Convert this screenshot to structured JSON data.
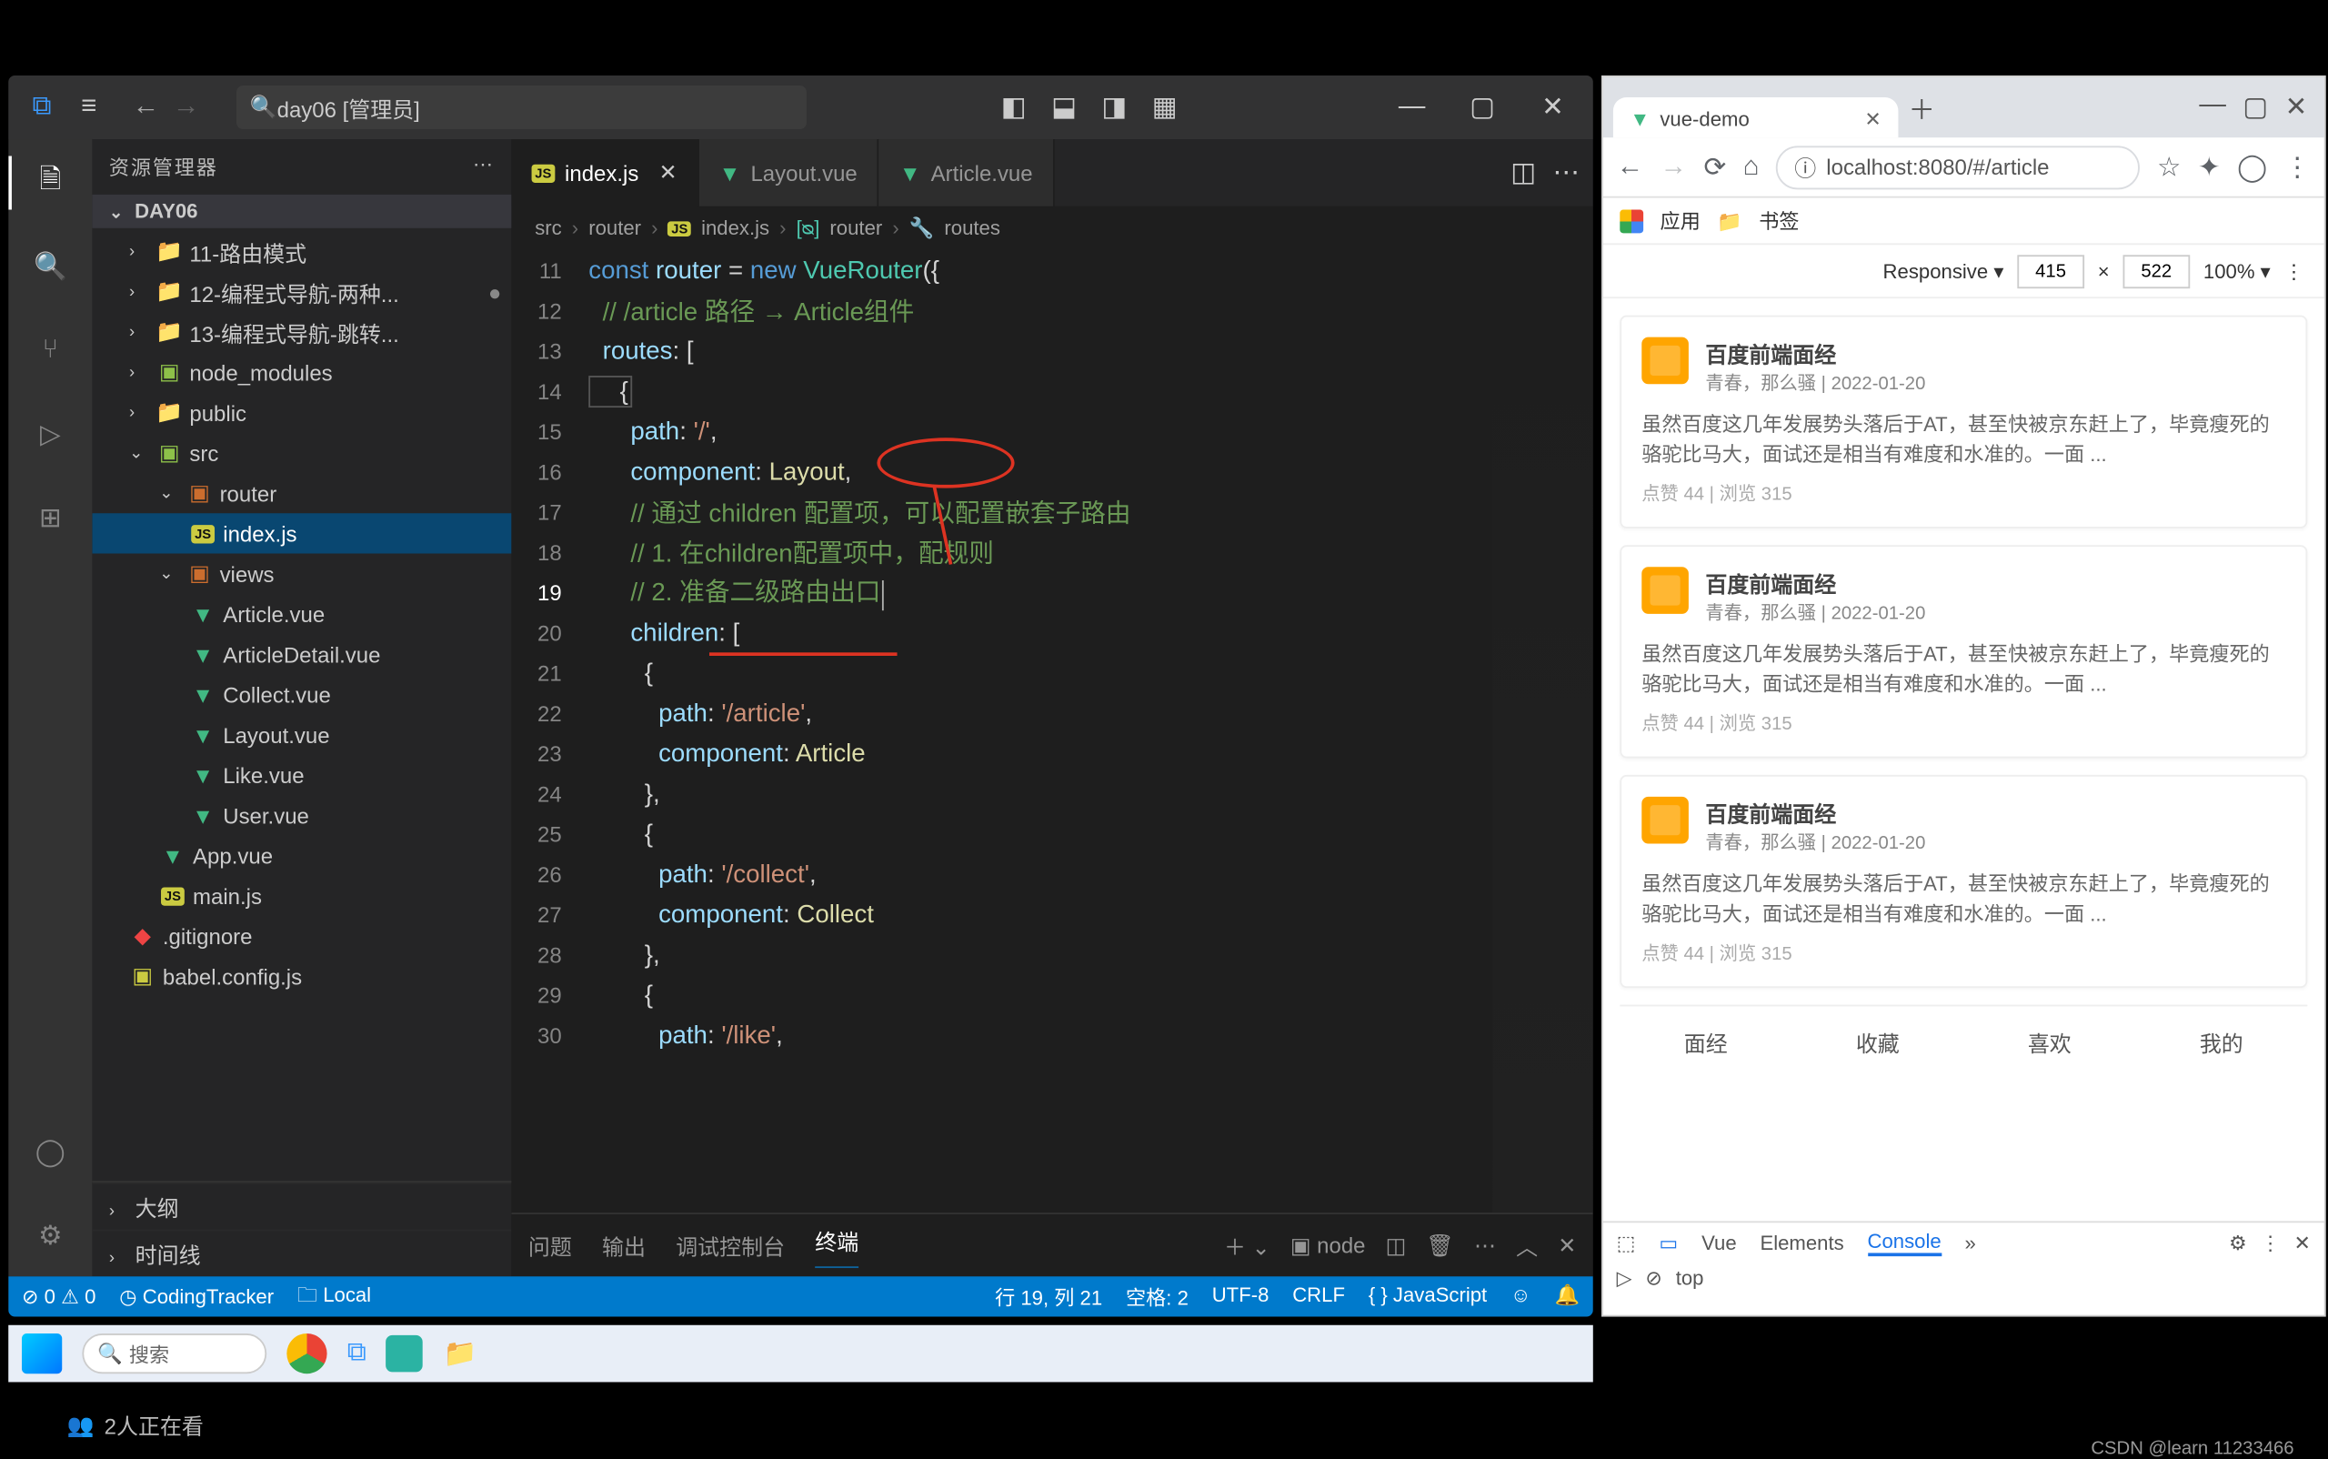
{
  "vscode": {
    "search_placeholder": "day06 [管理员]",
    "explorer_title": "资源管理器",
    "project_name": "DAY06",
    "tree": {
      "f1": "11-路由模式",
      "f2": "12-编程式导航-两种...",
      "f3": "13-编程式导航-跳转...",
      "nm": "node_modules",
      "pub": "public",
      "src": "src",
      "router": "router",
      "indexjs": "index.js",
      "views": "views",
      "article": "Article.vue",
      "artdetail": "ArticleDetail.vue",
      "collect": "Collect.vue",
      "layout": "Layout.vue",
      "like": "Like.vue",
      "user": "User.vue",
      "app": "App.vue",
      "main": "main.js",
      "gitig": ".gitignore",
      "babel": "babel.config.js",
      "outline": "大纲",
      "timeline": "时间线"
    },
    "tabs": {
      "index": "index.js",
      "layout": "Layout.vue",
      "article": "Article.vue"
    },
    "breadcrumb": [
      "src",
      "router",
      "index.js",
      "router",
      "routes"
    ],
    "code": {
      "l11a": "const ",
      "l11b": "router",
      "l11c": " = ",
      "l11d": "new ",
      "l11e": "VueRouter",
      "l11f": "({",
      "l12": "  // /article 路径 → Article组件",
      "l13a": "  routes",
      "l13b": ": [",
      "l14": "    {",
      "l15a": "      path",
      "l15b": ": ",
      "l15c": "'/'",
      "l15d": ",",
      "l16a": "      component",
      "l16b": ": ",
      "l16c": "Layout",
      "l16d": ",",
      "l17": "      // 通过 children 配置项，可以配置嵌套子路由",
      "l18": "      // 1. 在children配置项中，配规则",
      "l19": "      // 2. 准备二级路由出口",
      "l20a": "      children",
      "l20b": ": [",
      "l21": "        {",
      "l22a": "          path",
      "l22b": ": ",
      "l22c": "'/article'",
      "l22d": ",",
      "l23a": "          component",
      "l23b": ": ",
      "l23c": "Article",
      "l24": "        },",
      "l25": "        {",
      "l26a": "          path",
      "l26b": ": ",
      "l26c": "'/collect'",
      "l26d": ",",
      "l27a": "          component",
      "l27b": ": ",
      "l27c": "Collect",
      "l28": "        },",
      "l29": "        {",
      "l30a": "          path",
      "l30b": ": ",
      "l30c": "'/like'",
      "l30d": ","
    },
    "panel": {
      "problems": "问题",
      "output": "输出",
      "debug": "调试控制台",
      "terminal": "终端",
      "node": "node"
    },
    "status": {
      "errors": "0",
      "warnings": "0",
      "tracker": "CodingTracker",
      "local": "Local",
      "pos": "行 19, 列 21",
      "spaces": "空格: 2",
      "enc": "UTF-8",
      "eol": "CRLF",
      "lang": "JavaScript"
    }
  },
  "chrome": {
    "tab_title": "vue-demo",
    "url": "localhost:8080/#/article",
    "bookmarks": {
      "apps": "应用",
      "bk": "书签"
    },
    "responsive": "Responsive",
    "w": "415",
    "h": "522",
    "zoom": "100%",
    "article": {
      "title": "百度前端面经",
      "sub": "青春，那么骚 | 2022-01-20",
      "body": "虽然百度这几年发展势头落后于AT，甚至快被京东赶上了，毕竟瘦死的骆驼比马大，面试还是相当有难度和水准的。一面 ...",
      "foot": "点赞 44 | 浏览 315"
    },
    "tabs": [
      "面经",
      "收藏",
      "喜欢",
      "我的"
    ],
    "devtools": {
      "vue": "Vue",
      "el": "Elements",
      "con": "Console",
      "top": "top"
    }
  },
  "winbar": {
    "search": "搜索"
  },
  "live": "2人正在看",
  "watermark": "CSDN @learn 11233466"
}
